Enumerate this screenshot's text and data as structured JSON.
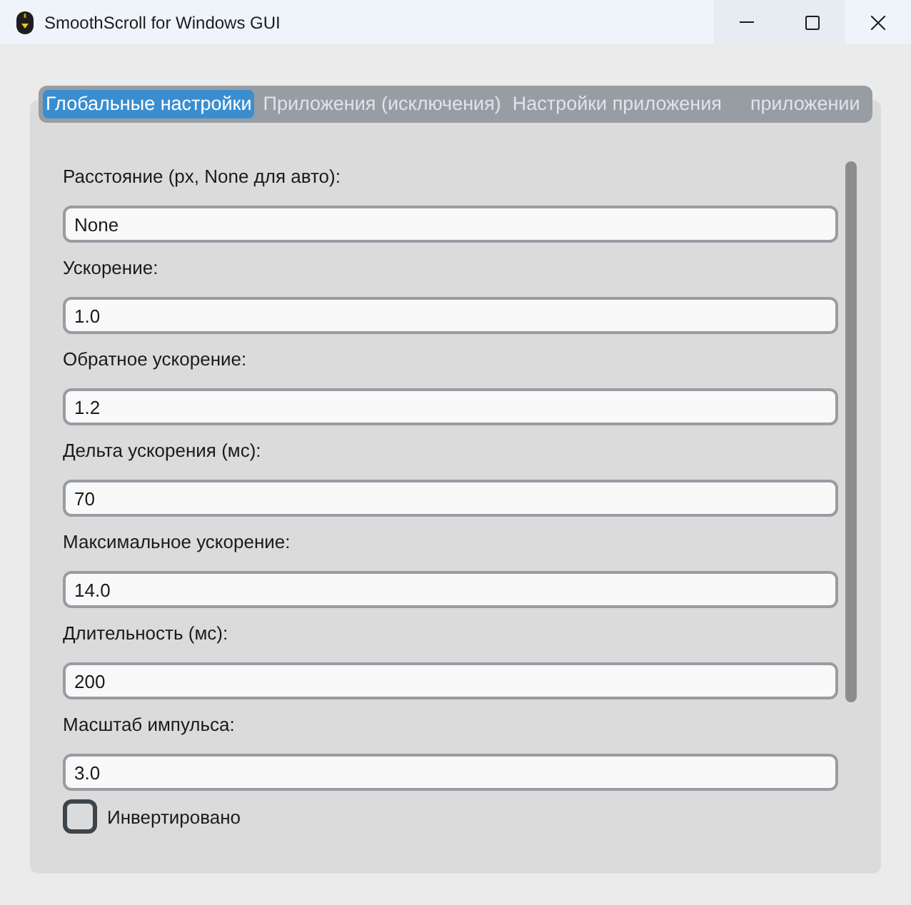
{
  "window": {
    "title": "SmoothScroll for Windows GUI"
  },
  "tabs": [
    {
      "label": "Глобальные настройки",
      "selected": true
    },
    {
      "label": "Приложения (исключения)",
      "selected": false
    },
    {
      "label": "Настройки приложения",
      "selected": false
    },
    {
      "label": "приложении",
      "selected": false
    }
  ],
  "settings": [
    {
      "kind": "field",
      "label": "Расстояние (px, None для авто):",
      "value": "None"
    },
    {
      "kind": "field",
      "label": "Ускорение:",
      "value": "1.0"
    },
    {
      "kind": "field",
      "label": "Обратное ускорение:",
      "value": "1.2"
    },
    {
      "kind": "field",
      "label": "Дельта ускорения (мс):",
      "value": "70"
    },
    {
      "kind": "field",
      "label": "Максимальное ускорение:",
      "value": "14.0"
    },
    {
      "kind": "field",
      "label": "Длительность (мс):",
      "value": "200"
    },
    {
      "kind": "field",
      "label": "Масштаб импульса:",
      "value": "3.0"
    },
    {
      "kind": "checkbox",
      "label": "Инвертировано",
      "checked": false
    }
  ]
}
